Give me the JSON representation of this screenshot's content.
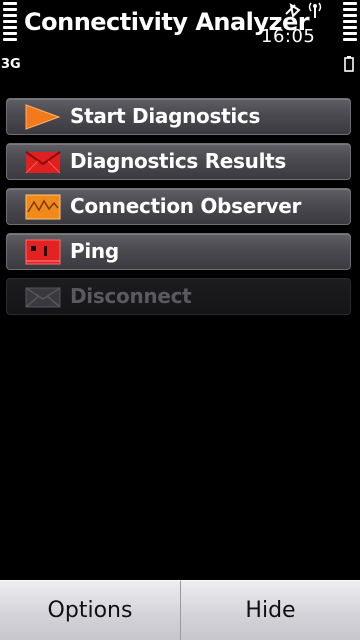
{
  "status_bar": {
    "title": "Connectivity Analyzer",
    "clock": "16:05",
    "network": "3G",
    "indicators": [
      "alarm-icon",
      "antenna-icon",
      "battery-icon"
    ]
  },
  "menu": {
    "items": [
      {
        "label": "Start Diagnostics",
        "icon": "play-triangle-icon",
        "enabled": true
      },
      {
        "label": "Diagnostics Results",
        "icon": "envelope-icon",
        "enabled": true
      },
      {
        "label": "Connection Observer",
        "icon": "graph-icon",
        "enabled": true
      },
      {
        "label": "Ping",
        "icon": "ping-icon",
        "enabled": true
      },
      {
        "label": "Disconnect",
        "icon": "disconnect-envelope-icon",
        "enabled": false
      }
    ]
  },
  "softkeys": {
    "left": "Options",
    "right": "Hide"
  },
  "colors": {
    "accent_orange": "#f07a1c",
    "accent_red": "#e52222",
    "button_gray": "#4b4a50",
    "softkey_light": "#dcdbe0"
  }
}
